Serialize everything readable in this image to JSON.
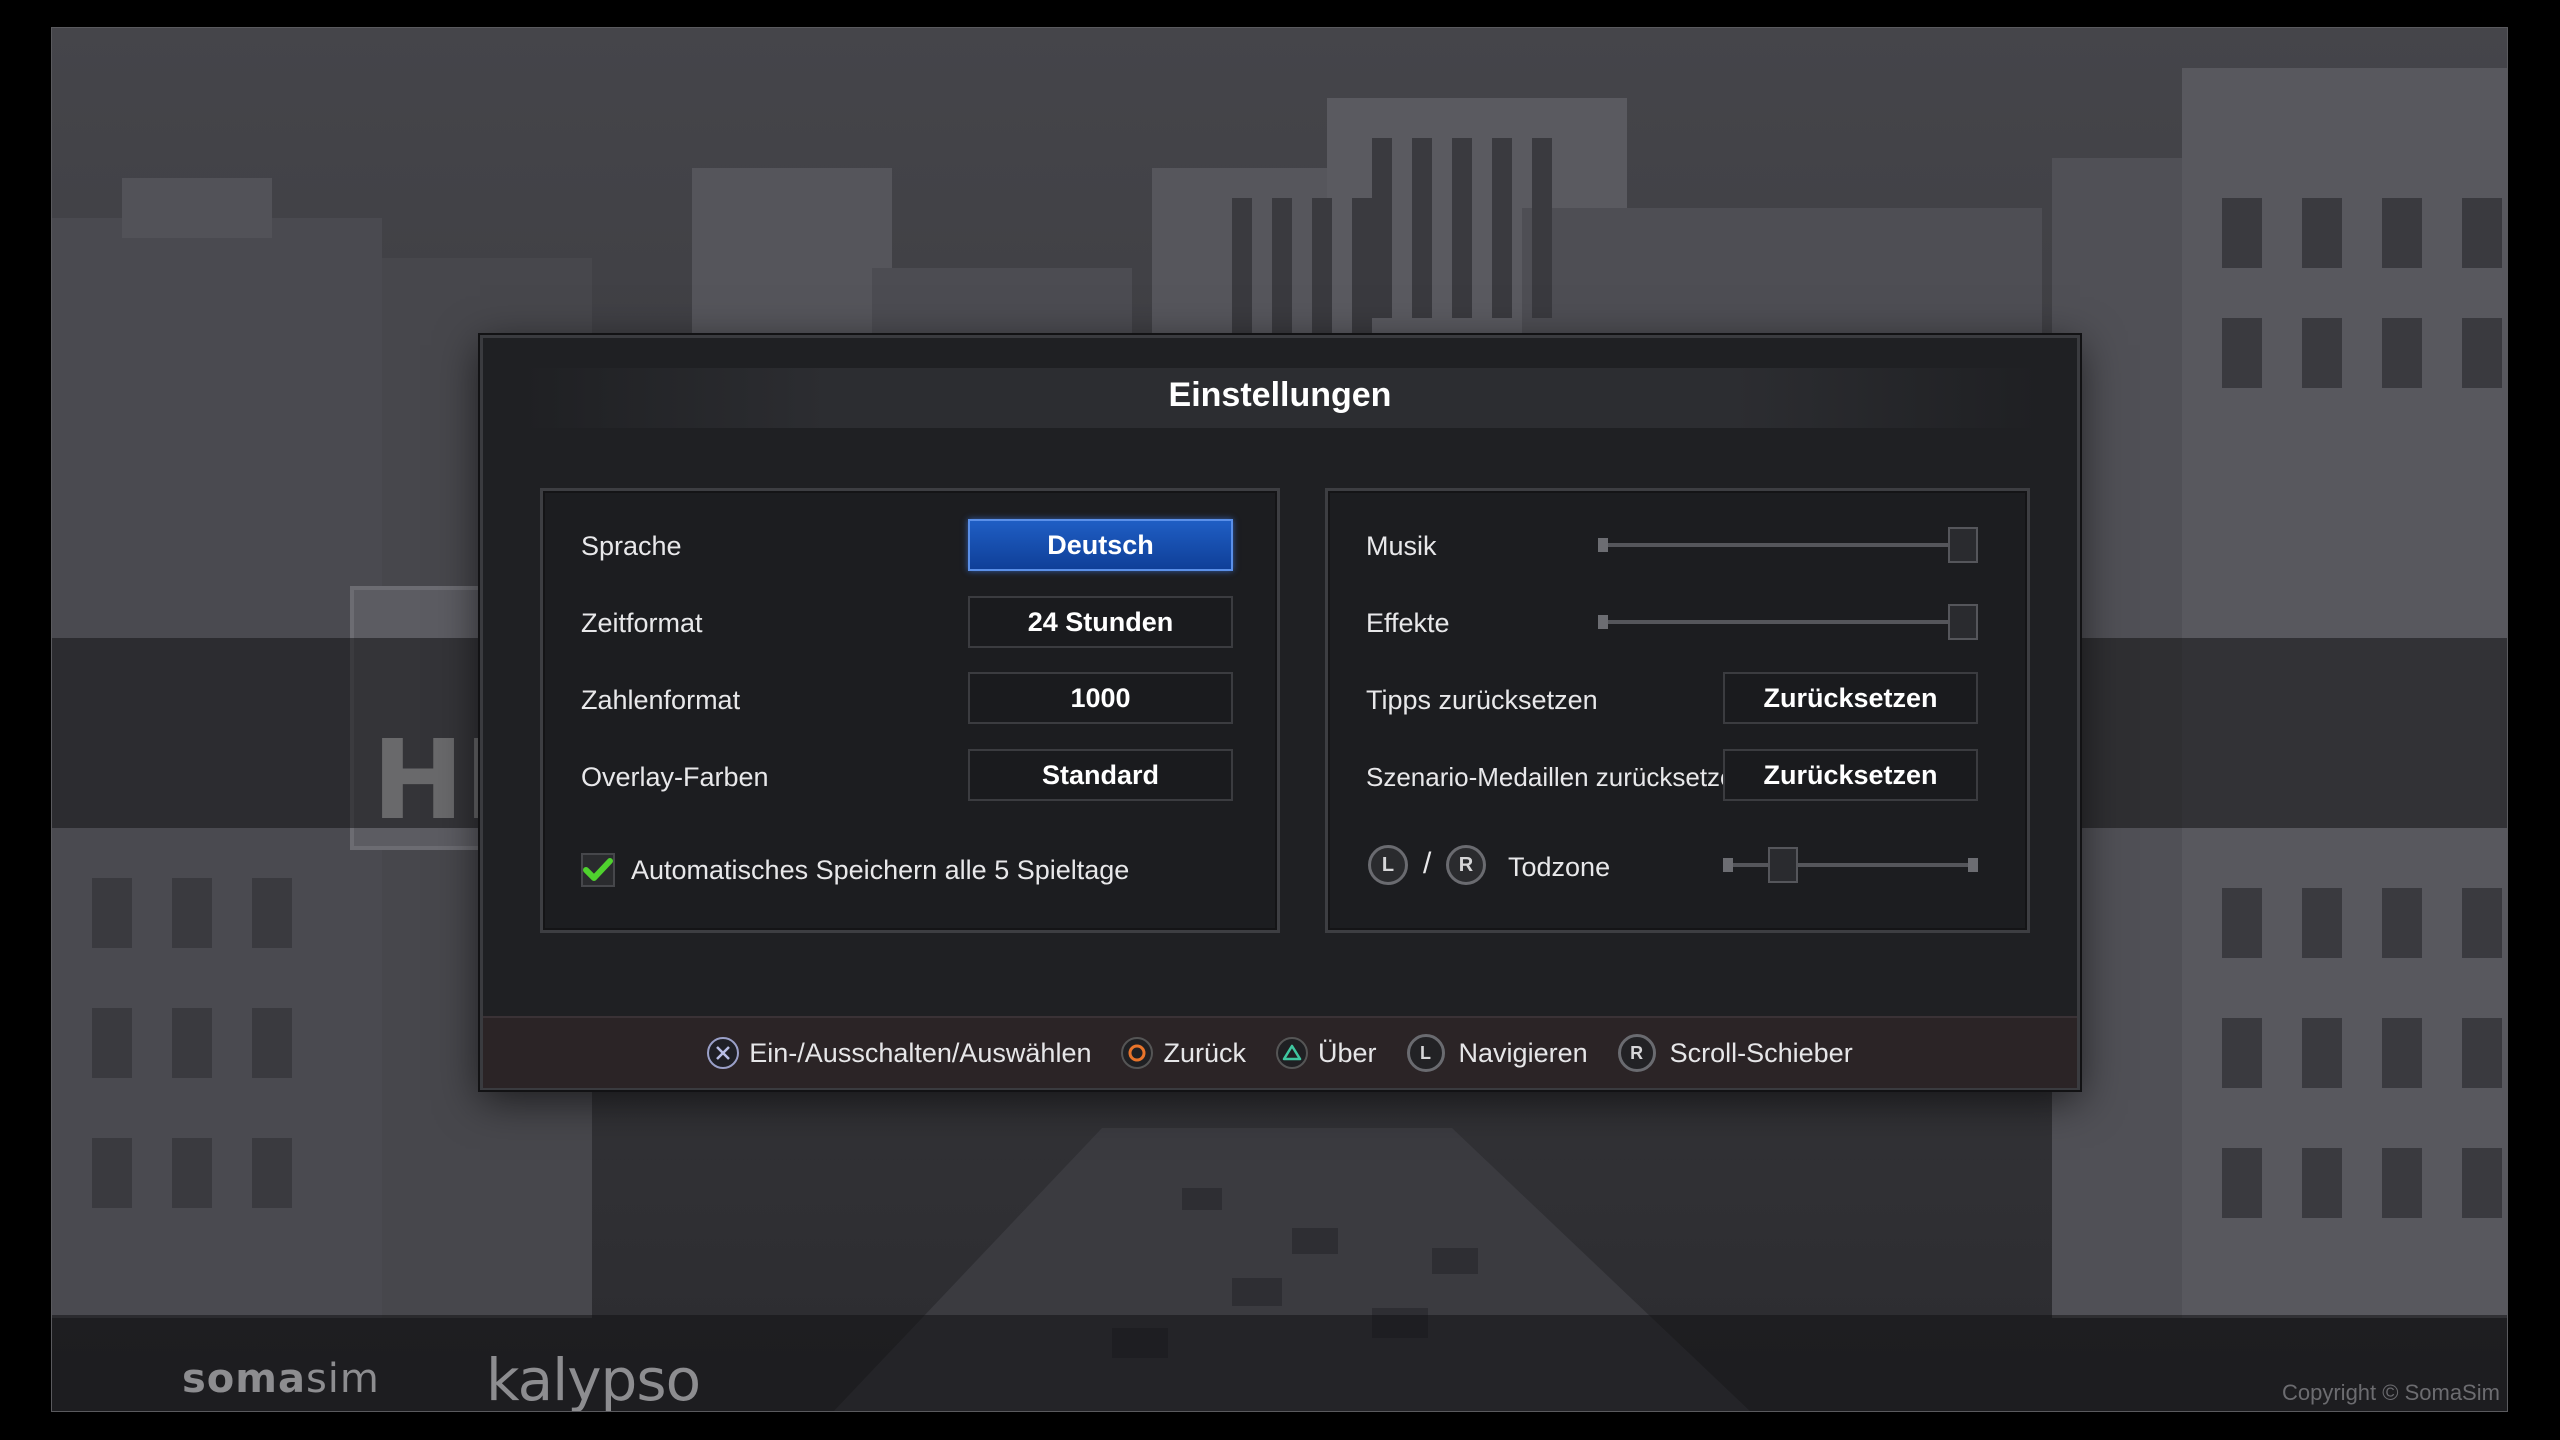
{
  "dialog": {
    "title": "Einstellungen"
  },
  "left_panel": {
    "rows": [
      {
        "label": "Sprache",
        "value": "Deutsch"
      },
      {
        "label": "Zeitformat",
        "value": "24 Stunden"
      },
      {
        "label": "Zahlenformat",
        "value": "1000"
      },
      {
        "label": "Overlay-Farben",
        "value": "Standard"
      }
    ],
    "autosave": {
      "label": "Automatisches Speichern alle 5 Spieltage",
      "checked": true
    }
  },
  "right_panel": {
    "music": {
      "label": "Musik",
      "level": 1.0
    },
    "effects": {
      "label": "Effekte",
      "level": 1.0
    },
    "reset_tips": {
      "label": "Tipps zurücksetzen",
      "button": "Zurücksetzen"
    },
    "reset_medals": {
      "label": "Szenario-Medaillen zurücksetzen",
      "button": "Zurücksetzen"
    },
    "deadzone": {
      "left_stick": "L",
      "separator": "/",
      "right_stick": "R",
      "label": "Todzone",
      "level": 0.2
    }
  },
  "hints": [
    {
      "icon": "cross-button-icon",
      "text": "Ein-/Ausschalten/Auswählen"
    },
    {
      "icon": "circle-button-icon",
      "text": "Zurück"
    },
    {
      "icon": "triangle-button-icon",
      "text": "Über"
    },
    {
      "icon": "left-stick-icon",
      "glyph": "L",
      "text": "Navigieren"
    },
    {
      "icon": "right-stick-icon",
      "glyph": "R",
      "text": "Scroll-Schieber"
    }
  ],
  "footer": {
    "logo_soma_bold": "soma",
    "logo_soma_thin": "sim",
    "logo_kalypso": "kalypso",
    "copyright": "Copyright © SomaSim"
  },
  "colors": {
    "selected_accent": "#1f5ec4",
    "checkmark": "#4fd22e",
    "circle_button": "#e8742a",
    "triangle_button": "#3fc7a0"
  }
}
